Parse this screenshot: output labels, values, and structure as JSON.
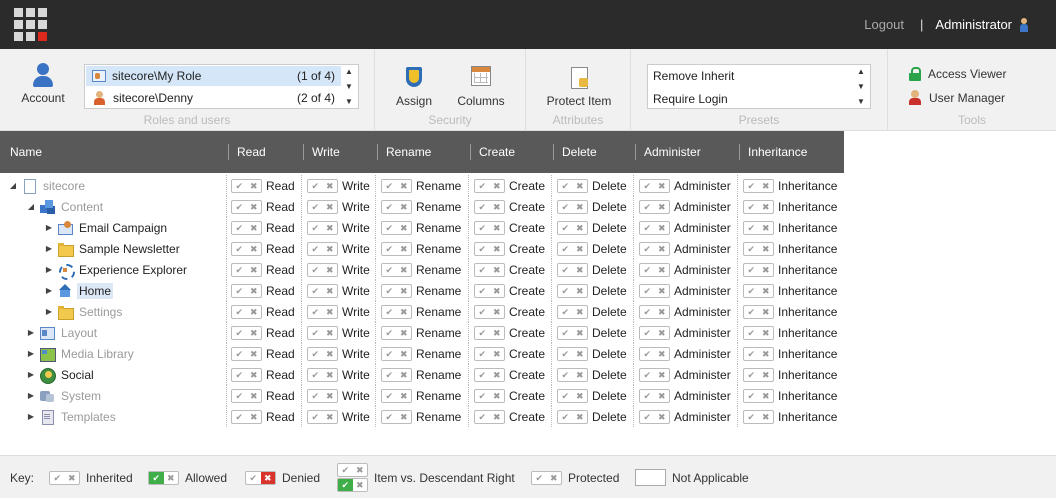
{
  "topbar": {
    "logout": "Logout",
    "separator": "|",
    "user": "Administrator"
  },
  "ribbon": {
    "account_label": "Account",
    "roles_group_title": "Roles and users",
    "roles": [
      {
        "name": "sitecore\\My Role",
        "count": "(1 of 4)"
      },
      {
        "name": "sitecore\\Denny",
        "count": "(2 of 4)"
      }
    ],
    "security_title": "Security",
    "assign_label": "Assign",
    "columns_label": "Columns",
    "attributes_title": "Attributes",
    "protect_label": "Protect Item",
    "presets_title": "Presets",
    "presets": [
      "Remove Inherit",
      "Require Login"
    ],
    "tools_title": "Tools",
    "access_viewer": "Access Viewer",
    "user_manager": "User Manager"
  },
  "grid": {
    "headers": [
      "Name",
      "Read",
      "Write",
      "Rename",
      "Create",
      "Delete",
      "Administer",
      "Inheritance"
    ],
    "rights": [
      "Read",
      "Write",
      "Rename",
      "Create",
      "Delete",
      "Administer",
      "Inheritance"
    ],
    "rows": [
      {
        "name": "sitecore",
        "level": 0,
        "arrow": "◢",
        "icon": "doc",
        "muted": true
      },
      {
        "name": "Content",
        "level": 1,
        "arrow": "◢",
        "icon": "content",
        "muted": true
      },
      {
        "name": "Email Campaign",
        "level": 2,
        "arrow": "▶",
        "icon": "mail",
        "muted": false
      },
      {
        "name": "Sample Newsletter",
        "level": 2,
        "arrow": "▶",
        "icon": "folder",
        "muted": false
      },
      {
        "name": "Experience Explorer",
        "level": 2,
        "arrow": "▶",
        "icon": "explore",
        "muted": false
      },
      {
        "name": "Home",
        "level": 2,
        "arrow": "▶",
        "icon": "home",
        "muted": false,
        "selected": true
      },
      {
        "name": "Settings",
        "level": 2,
        "arrow": "▶",
        "icon": "folder",
        "muted": true
      },
      {
        "name": "Layout",
        "level": 1,
        "arrow": "▶",
        "icon": "layout",
        "muted": true
      },
      {
        "name": "Media Library",
        "level": 1,
        "arrow": "▶",
        "icon": "media",
        "muted": true
      },
      {
        "name": "Social",
        "level": 1,
        "arrow": "▶",
        "icon": "social",
        "muted": false
      },
      {
        "name": "System",
        "level": 1,
        "arrow": "▶",
        "icon": "system",
        "muted": true
      },
      {
        "name": "Templates",
        "level": 1,
        "arrow": "▶",
        "icon": "templates",
        "muted": true
      }
    ]
  },
  "key": {
    "label": "Key:",
    "inherited": "Inherited",
    "allowed": "Allowed",
    "denied": "Denied",
    "item_vs_desc": "Item vs. Descendant Right",
    "protected": "Protected",
    "not_applicable": "Not Applicable"
  },
  "colors": {
    "header_bg": "#595959",
    "topbar_bg": "#2b2b2b",
    "selected_role": "#d4e6f7",
    "allow": "#3fae49",
    "deny": "#d9342b"
  }
}
